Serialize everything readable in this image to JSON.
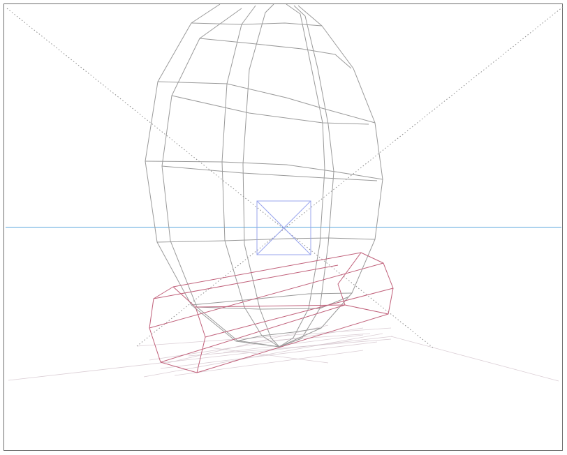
{
  "scene": {
    "colors": {
      "background": "#ffffff",
      "frame": "#6d6d6d",
      "horizon": "#5aa6dc",
      "perspective_guides": "#8a8a8a",
      "egg_wireframe": "#9a9a9a",
      "prism_wireframe": "#c0607a",
      "shadow": "#cdbcc6",
      "focus_box": "#9aa6ee"
    }
  }
}
